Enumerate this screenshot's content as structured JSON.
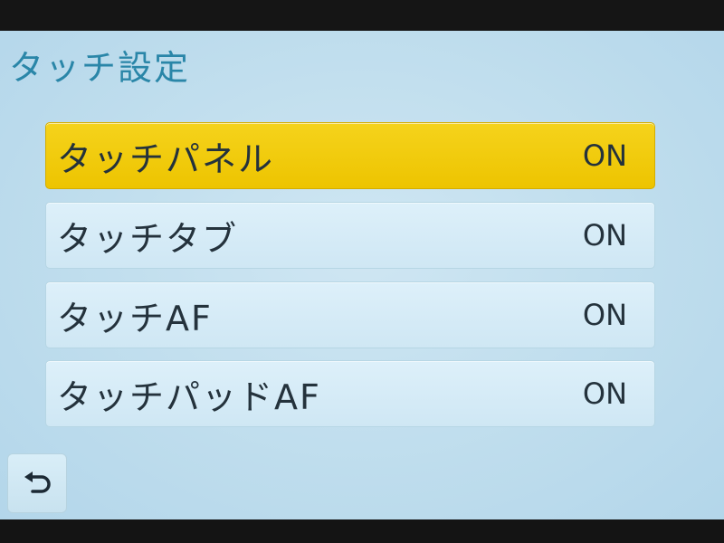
{
  "title": "タッチ設定",
  "menu": {
    "items": [
      {
        "label": "タッチパネル",
        "value": "ON",
        "selected": true
      },
      {
        "label": "タッチタブ",
        "value": "ON",
        "selected": false
      },
      {
        "label": "タッチAF",
        "value": "ON",
        "selected": false
      },
      {
        "label": "タッチパッドAF",
        "value": "ON",
        "selected": false
      }
    ]
  },
  "back_button": {
    "icon": "return-arrow-icon"
  },
  "colors": {
    "title": "#2a86a8",
    "selected_bg": "#f0c800",
    "item_bg": "#d6ecf7",
    "text": "#24323c",
    "screen_bg": "#c2dfee"
  }
}
